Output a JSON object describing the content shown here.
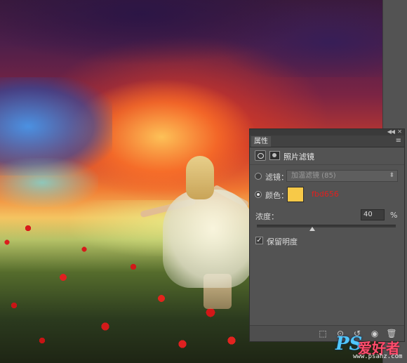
{
  "panel": {
    "tab_label": "属性",
    "collapse_glyph": "◀◀",
    "close_glyph": "✕",
    "menu_glyph": "≡",
    "adjustment_title": "照片滤镜",
    "filter_row": {
      "label": "滤镜：",
      "selected": "加温滤镜 (85)"
    },
    "color_row": {
      "label": "颜色：",
      "swatch_color": "#f7c948",
      "hex_text": "fbd656",
      "hex_text_color": "#e0201f"
    },
    "density": {
      "label": "浓度：",
      "value": "40",
      "unit": "%",
      "slider_fraction": 0.4
    },
    "preserve": {
      "label": "保留明度",
      "checked": true,
      "check_glyph": "✓"
    },
    "footer_icons": [
      {
        "name": "clip-to-layer-icon",
        "glyph": "⬚"
      },
      {
        "name": "view-previous-state-icon",
        "glyph": "⊙"
      },
      {
        "name": "reset-icon",
        "glyph": "↺"
      },
      {
        "name": "visibility-eye-icon",
        "glyph": "◉"
      },
      {
        "name": "delete-trash-icon",
        "glyph": "🗑"
      }
    ]
  },
  "watermark": {
    "logo": "PS",
    "cn_text": "爱好者",
    "url": "www.psahz.com"
  }
}
